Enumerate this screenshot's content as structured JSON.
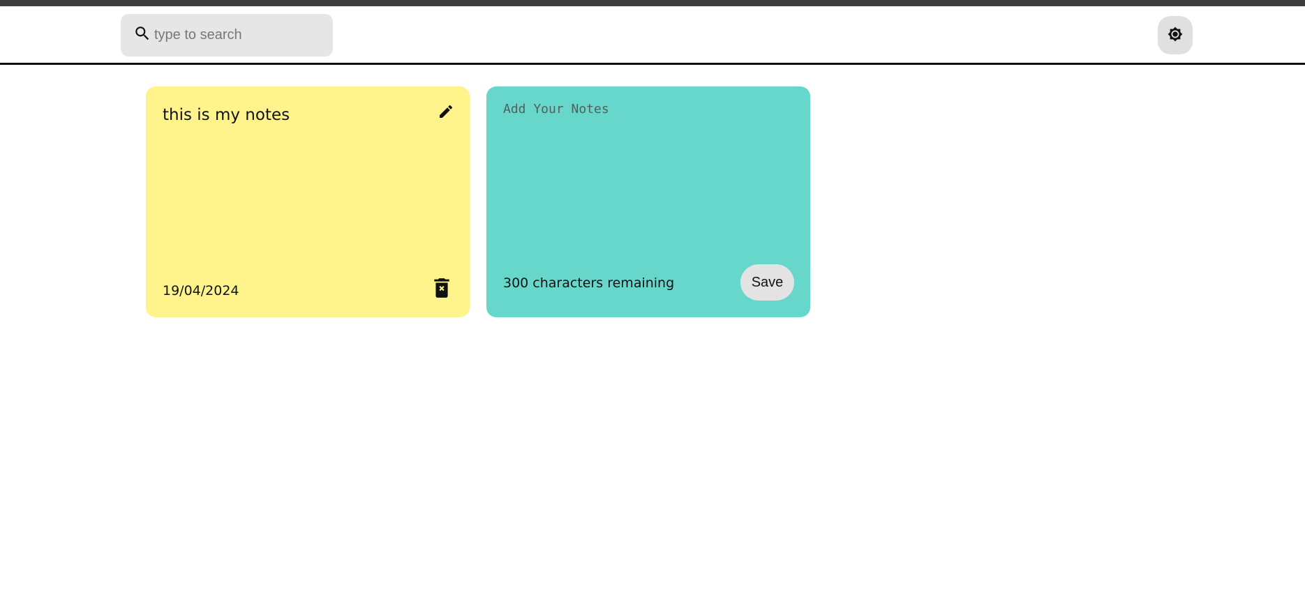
{
  "header": {
    "search": {
      "placeholder": "type to search",
      "value": "",
      "icon": "search-icon"
    },
    "theme_toggle": {
      "icon": "brightness-icon"
    }
  },
  "notes": [
    {
      "text": "this is my notes",
      "date": "19/04/2024",
      "edit_icon": "pencil-icon",
      "delete_icon": "trash-icon",
      "color": "#fef48b"
    }
  ],
  "new_note": {
    "placeholder": "Add Your Notes",
    "value": "",
    "chars_remaining": "300 characters remaining",
    "save_label": "Save",
    "color": "#68d7cb"
  },
  "colors": {
    "top_strip": "#3d3d3d",
    "search_bg": "#e6e6e6",
    "header_border": "#111111"
  }
}
